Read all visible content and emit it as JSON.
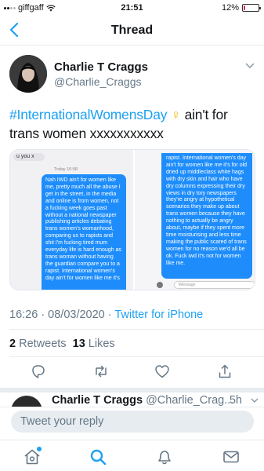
{
  "status": {
    "carrier": "giffgaff",
    "time": "21:51",
    "battery": "12%",
    "battery_fraction": 0.12
  },
  "nav": {
    "title": "Thread"
  },
  "tweet": {
    "author": "Charlie T Craggs",
    "handle": "@Charlie_Craggs",
    "hashtag": "#InternationalWomensDay",
    "emoji": "♀",
    "text": " ain't for trans women xxxxxxxxxxx",
    "timestamp": "16:26 · 08/03/2020 · ",
    "source": "Twitter for iPhone",
    "retweets_count": "2",
    "retweets_label": "Retweets",
    "likes_count": "13",
    "likes_label": "Likes"
  },
  "media": {
    "left": {
      "stub": "u you x",
      "time": "Today 16:58",
      "bubble": "Nah IWD ain't for women like me, pretty much all the abuse I get in the street, in the media and online is from women, not a fucking week goes past without a national newspaper publishing articles debating trans women's womanhood, comparing us to rapists and shit I'm fucking tired mum everyday life is hard enough as trans woman without having the guardian compare you to a rapist. International women's day ain't for women like me it's"
    },
    "right": {
      "bubble": "rapist. International women's day ain't for women like me it's for old dried up middleclass white hags with dry skin and hair who have dry columns expressing their dry views in dry tory newspapers they're angry at hypothetical scenarios they make up about trans women because they have nothing to actually be angry about, maybe if they spent more time moisturising and less time making the public scared of trans women for no reason we'd all be ok. Fuck iwd it's not for women like me.",
      "input_placeholder": "iMessage"
    }
  },
  "next_tweet": {
    "author": "Charlie T Craggs",
    "handle": "@Charlie_Crag...",
    "time": "5h"
  },
  "reply": {
    "placeholder": "Tweet your reply"
  },
  "colors": {
    "accent": "#1da1f2",
    "bubble": "#1e8dfb",
    "text": "#14171a",
    "muted": "#657786"
  }
}
